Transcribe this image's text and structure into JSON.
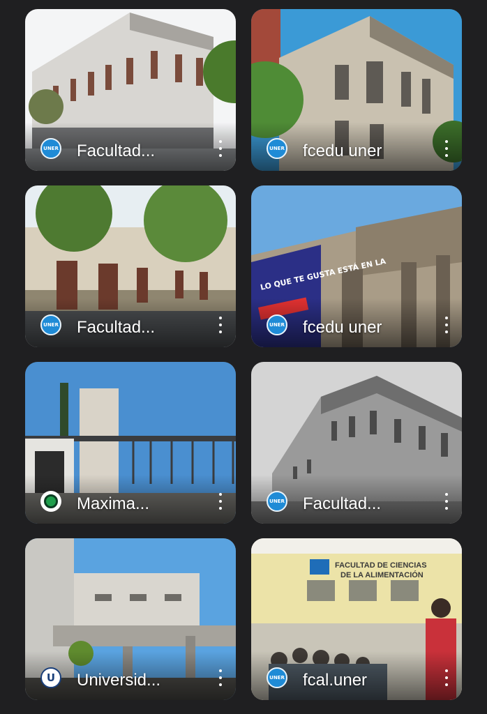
{
  "cards": [
    {
      "title": "Facultad...",
      "avatar": "UNER",
      "avatar_icon": "uner-logo-icon"
    },
    {
      "title": "fcedu uner",
      "avatar": "UNER",
      "avatar_icon": "uner-logo-icon"
    },
    {
      "title": "Facultad...",
      "avatar": "UNER",
      "avatar_icon": "uner-logo-icon"
    },
    {
      "title": "fcedu uner",
      "avatar": "UNER",
      "avatar_icon": "uner-logo-icon"
    },
    {
      "title": "Maxima...",
      "avatar": "",
      "avatar_icon": "green-ring-icon"
    },
    {
      "title": "Facultad...",
      "avatar": "UNER",
      "avatar_icon": "uner-logo-icon"
    },
    {
      "title": "Universid...",
      "avatar": "U",
      "avatar_icon": "u-logo-icon"
    },
    {
      "title": "fcal.uner",
      "avatar": "UNER",
      "avatar_icon": "uner-logo-icon"
    }
  ],
  "photo_text": {
    "banner": "LO QUE TE GUSTA ESTÁ EN LA",
    "sign": "Facultad de Ciencias de la Alimentación",
    "sign_top": "FACULTAD DE CIENCIAS",
    "sign_bottom": "DE LA ALIMENTACIÓN"
  },
  "colors": {
    "background": "#1f1f21",
    "uner_blue": "#1f8bd6",
    "more_icon": "#ffffff"
  }
}
